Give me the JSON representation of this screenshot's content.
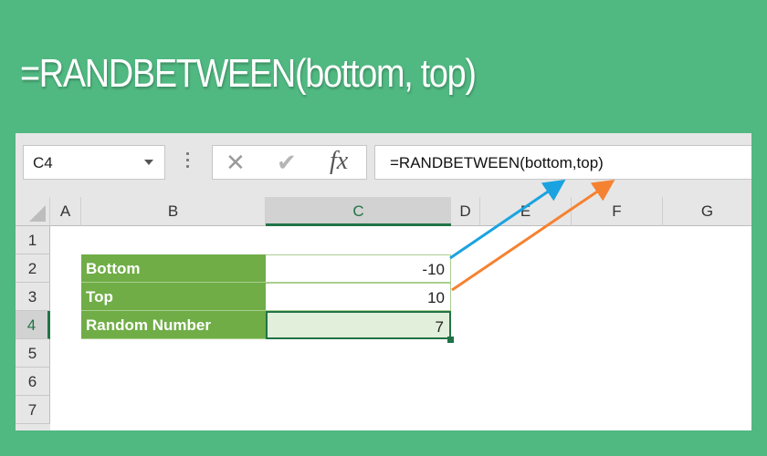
{
  "banner": {
    "title": "=RANDBETWEEN(bottom, top)"
  },
  "formula_bar": {
    "name_box": "C4",
    "cancel_icon": "close-icon",
    "enter_icon": "check-icon",
    "function_icon": "fx-icon",
    "fx_label": "fx",
    "formula": "=RANDBETWEEN(bottom,top)"
  },
  "columns": [
    "A",
    "B",
    "C",
    "D",
    "E",
    "F",
    "G"
  ],
  "selected_column": "C",
  "rows": [
    "1",
    "2",
    "3",
    "4",
    "5",
    "6",
    "7"
  ],
  "selected_row": "4",
  "table": [
    {
      "label": "Bottom",
      "value": "-10"
    },
    {
      "label": "Top",
      "value": "10"
    },
    {
      "label": "Random Number",
      "value": "7"
    }
  ],
  "colors": {
    "background": "#50b881",
    "header_fill": "#70ad47",
    "selection": "#217346",
    "arrow_bottom": "#1aa3e0",
    "arrow_top": "#f58231"
  }
}
